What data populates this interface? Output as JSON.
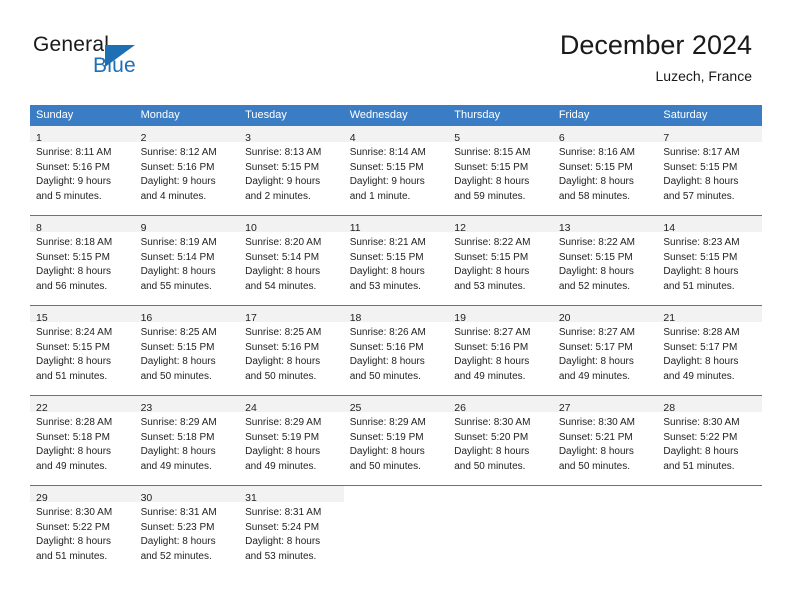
{
  "brand": {
    "name_part1": "General",
    "name_part2": "Blue",
    "accent_color": "#1f6fb5"
  },
  "header": {
    "title": "December 2024",
    "subtitle": "Luzech, France"
  },
  "calendar": {
    "header_color": "#3b7dc4",
    "daynum_band_color": "#f2f2f2",
    "weekday_names": [
      "Sunday",
      "Monday",
      "Tuesday",
      "Wednesday",
      "Thursday",
      "Friday",
      "Saturday"
    ],
    "weeks": [
      [
        {
          "day": "1",
          "sunrise": "Sunrise: 8:11 AM",
          "sunset": "Sunset: 5:16 PM",
          "daylight_line1": "Daylight: 9 hours",
          "daylight_line2": "and 5 minutes."
        },
        {
          "day": "2",
          "sunrise": "Sunrise: 8:12 AM",
          "sunset": "Sunset: 5:16 PM",
          "daylight_line1": "Daylight: 9 hours",
          "daylight_line2": "and 4 minutes."
        },
        {
          "day": "3",
          "sunrise": "Sunrise: 8:13 AM",
          "sunset": "Sunset: 5:15 PM",
          "daylight_line1": "Daylight: 9 hours",
          "daylight_line2": "and 2 minutes."
        },
        {
          "day": "4",
          "sunrise": "Sunrise: 8:14 AM",
          "sunset": "Sunset: 5:15 PM",
          "daylight_line1": "Daylight: 9 hours",
          "daylight_line2": "and 1 minute."
        },
        {
          "day": "5",
          "sunrise": "Sunrise: 8:15 AM",
          "sunset": "Sunset: 5:15 PM",
          "daylight_line1": "Daylight: 8 hours",
          "daylight_line2": "and 59 minutes."
        },
        {
          "day": "6",
          "sunrise": "Sunrise: 8:16 AM",
          "sunset": "Sunset: 5:15 PM",
          "daylight_line1": "Daylight: 8 hours",
          "daylight_line2": "and 58 minutes."
        },
        {
          "day": "7",
          "sunrise": "Sunrise: 8:17 AM",
          "sunset": "Sunset: 5:15 PM",
          "daylight_line1": "Daylight: 8 hours",
          "daylight_line2": "and 57 minutes."
        }
      ],
      [
        {
          "day": "8",
          "sunrise": "Sunrise: 8:18 AM",
          "sunset": "Sunset: 5:15 PM",
          "daylight_line1": "Daylight: 8 hours",
          "daylight_line2": "and 56 minutes."
        },
        {
          "day": "9",
          "sunrise": "Sunrise: 8:19 AM",
          "sunset": "Sunset: 5:14 PM",
          "daylight_line1": "Daylight: 8 hours",
          "daylight_line2": "and 55 minutes."
        },
        {
          "day": "10",
          "sunrise": "Sunrise: 8:20 AM",
          "sunset": "Sunset: 5:14 PM",
          "daylight_line1": "Daylight: 8 hours",
          "daylight_line2": "and 54 minutes."
        },
        {
          "day": "11",
          "sunrise": "Sunrise: 8:21 AM",
          "sunset": "Sunset: 5:15 PM",
          "daylight_line1": "Daylight: 8 hours",
          "daylight_line2": "and 53 minutes."
        },
        {
          "day": "12",
          "sunrise": "Sunrise: 8:22 AM",
          "sunset": "Sunset: 5:15 PM",
          "daylight_line1": "Daylight: 8 hours",
          "daylight_line2": "and 53 minutes."
        },
        {
          "day": "13",
          "sunrise": "Sunrise: 8:22 AM",
          "sunset": "Sunset: 5:15 PM",
          "daylight_line1": "Daylight: 8 hours",
          "daylight_line2": "and 52 minutes."
        },
        {
          "day": "14",
          "sunrise": "Sunrise: 8:23 AM",
          "sunset": "Sunset: 5:15 PM",
          "daylight_line1": "Daylight: 8 hours",
          "daylight_line2": "and 51 minutes."
        }
      ],
      [
        {
          "day": "15",
          "sunrise": "Sunrise: 8:24 AM",
          "sunset": "Sunset: 5:15 PM",
          "daylight_line1": "Daylight: 8 hours",
          "daylight_line2": "and 51 minutes."
        },
        {
          "day": "16",
          "sunrise": "Sunrise: 8:25 AM",
          "sunset": "Sunset: 5:15 PM",
          "daylight_line1": "Daylight: 8 hours",
          "daylight_line2": "and 50 minutes."
        },
        {
          "day": "17",
          "sunrise": "Sunrise: 8:25 AM",
          "sunset": "Sunset: 5:16 PM",
          "daylight_line1": "Daylight: 8 hours",
          "daylight_line2": "and 50 minutes."
        },
        {
          "day": "18",
          "sunrise": "Sunrise: 8:26 AM",
          "sunset": "Sunset: 5:16 PM",
          "daylight_line1": "Daylight: 8 hours",
          "daylight_line2": "and 50 minutes."
        },
        {
          "day": "19",
          "sunrise": "Sunrise: 8:27 AM",
          "sunset": "Sunset: 5:16 PM",
          "daylight_line1": "Daylight: 8 hours",
          "daylight_line2": "and 49 minutes."
        },
        {
          "day": "20",
          "sunrise": "Sunrise: 8:27 AM",
          "sunset": "Sunset: 5:17 PM",
          "daylight_line1": "Daylight: 8 hours",
          "daylight_line2": "and 49 minutes."
        },
        {
          "day": "21",
          "sunrise": "Sunrise: 8:28 AM",
          "sunset": "Sunset: 5:17 PM",
          "daylight_line1": "Daylight: 8 hours",
          "daylight_line2": "and 49 minutes."
        }
      ],
      [
        {
          "day": "22",
          "sunrise": "Sunrise: 8:28 AM",
          "sunset": "Sunset: 5:18 PM",
          "daylight_line1": "Daylight: 8 hours",
          "daylight_line2": "and 49 minutes."
        },
        {
          "day": "23",
          "sunrise": "Sunrise: 8:29 AM",
          "sunset": "Sunset: 5:18 PM",
          "daylight_line1": "Daylight: 8 hours",
          "daylight_line2": "and 49 minutes."
        },
        {
          "day": "24",
          "sunrise": "Sunrise: 8:29 AM",
          "sunset": "Sunset: 5:19 PM",
          "daylight_line1": "Daylight: 8 hours",
          "daylight_line2": "and 49 minutes."
        },
        {
          "day": "25",
          "sunrise": "Sunrise: 8:29 AM",
          "sunset": "Sunset: 5:19 PM",
          "daylight_line1": "Daylight: 8 hours",
          "daylight_line2": "and 50 minutes."
        },
        {
          "day": "26",
          "sunrise": "Sunrise: 8:30 AM",
          "sunset": "Sunset: 5:20 PM",
          "daylight_line1": "Daylight: 8 hours",
          "daylight_line2": "and 50 minutes."
        },
        {
          "day": "27",
          "sunrise": "Sunrise: 8:30 AM",
          "sunset": "Sunset: 5:21 PM",
          "daylight_line1": "Daylight: 8 hours",
          "daylight_line2": "and 50 minutes."
        },
        {
          "day": "28",
          "sunrise": "Sunrise: 8:30 AM",
          "sunset": "Sunset: 5:22 PM",
          "daylight_line1": "Daylight: 8 hours",
          "daylight_line2": "and 51 minutes."
        }
      ],
      [
        {
          "day": "29",
          "sunrise": "Sunrise: 8:30 AM",
          "sunset": "Sunset: 5:22 PM",
          "daylight_line1": "Daylight: 8 hours",
          "daylight_line2": "and 51 minutes."
        },
        {
          "day": "30",
          "sunrise": "Sunrise: 8:31 AM",
          "sunset": "Sunset: 5:23 PM",
          "daylight_line1": "Daylight: 8 hours",
          "daylight_line2": "and 52 minutes."
        },
        {
          "day": "31",
          "sunrise": "Sunrise: 8:31 AM",
          "sunset": "Sunset: 5:24 PM",
          "daylight_line1": "Daylight: 8 hours",
          "daylight_line2": "and 53 minutes."
        },
        {
          "day": "",
          "sunrise": "",
          "sunset": "",
          "daylight_line1": "",
          "daylight_line2": ""
        },
        {
          "day": "",
          "sunrise": "",
          "sunset": "",
          "daylight_line1": "",
          "daylight_line2": ""
        },
        {
          "day": "",
          "sunrise": "",
          "sunset": "",
          "daylight_line1": "",
          "daylight_line2": ""
        },
        {
          "day": "",
          "sunrise": "",
          "sunset": "",
          "daylight_line1": "",
          "daylight_line2": ""
        }
      ]
    ]
  }
}
